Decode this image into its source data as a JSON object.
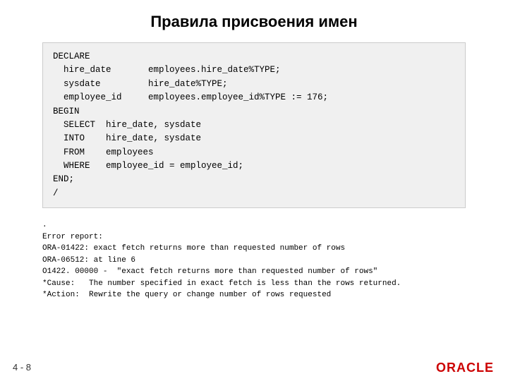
{
  "slide": {
    "title": "Правила присвоения имен",
    "slide_number": "4 - 8"
  },
  "code_block": {
    "content": "DECLARE\n  hire_date       employees.hire_date%TYPE;\n  sysdate         hire_date%TYPE;\n  employee_id     employees.employee_id%TYPE := 176;\nBEGIN\n  SELECT  hire_date, sysdate\n  INTO    hire_date, sysdate\n  FROM    employees\n  WHERE   employee_id = employee_id;\nEND;\n/"
  },
  "error_block": {
    "content": ".\nError report:\nORA-01422: exact fetch returns more than requested number of rows\nORA-06512: at line 6\nO1422. 00000 -  \"exact fetch returns more than requested number of rows\"\n*Cause:   The number specified in exact fetch is less than the rows returned.\n*Action:  Rewrite the query or change number of rows requested"
  },
  "oracle": {
    "label": "ORACLE"
  }
}
